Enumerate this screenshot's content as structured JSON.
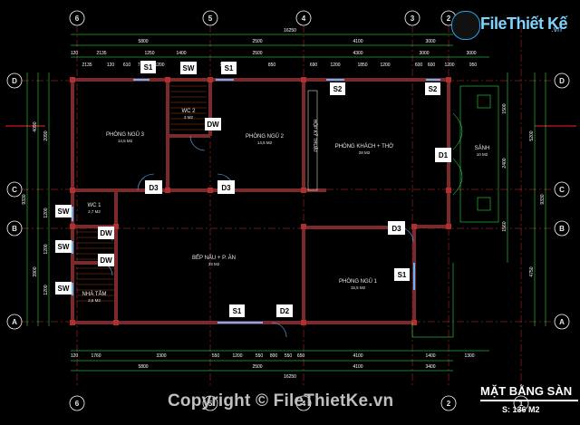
{
  "colors": {
    "wall": "#7a2a2a",
    "dim_line": "#39ff5a",
    "grid_line": "#ff4040",
    "hatch": "#ff6a2a",
    "window": "#5fb8ff",
    "tag_bg": "#ffffff"
  },
  "grid_axes": {
    "columns": [
      "6",
      "5",
      "4",
      "3",
      "2",
      "1"
    ],
    "rows": [
      "D",
      "C",
      "B",
      "A"
    ]
  },
  "overall": {
    "width_top": "16250",
    "width_bottom": "16250",
    "depth_left": "9330",
    "depth_right": "9330"
  },
  "dims_top": {
    "row1": [
      "5800",
      "2500",
      "4100",
      "3000"
    ],
    "row2": [
      "120",
      "2135",
      "1250",
      "1400",
      "2500",
      "4300",
      "3000",
      "3000"
    ],
    "row3": [
      "2135",
      "120",
      "610",
      "720",
      "1200",
      "990",
      "1200",
      "850",
      "690",
      "1200",
      "1850",
      "1200",
      "600",
      "600",
      "1200",
      "950"
    ]
  },
  "dims_bottom": {
    "row1": [
      "120",
      "1760",
      "3300",
      "550",
      "1200",
      "550",
      "800",
      "550",
      "650",
      "4100",
      "1400",
      "1300"
    ],
    "row2": [
      "5800",
      "2500",
      "4100",
      "3400"
    ]
  },
  "dims_left": [
    "4090",
    "3900",
    "9330",
    "2090",
    "1200",
    "1200",
    "1200"
  ],
  "dims_right": [
    "5200",
    "4750",
    "9330",
    "1500",
    "2400",
    "1560"
  ],
  "rooms": [
    {
      "name": "PHÒNG NGỦ 3",
      "area": "14,5 M2"
    },
    {
      "name": "WC 2",
      "area": "3 M2"
    },
    {
      "name": "PHÒNG NGỦ 2",
      "area": "14,5 M2"
    },
    {
      "name": "PHÒNG KHÁCH + THỜ",
      "area": "28 M2"
    },
    {
      "name": "SẢNH",
      "area": "10 M2"
    },
    {
      "name": "WC 1",
      "area": "2,7 M2"
    },
    {
      "name": "BẾP NẤU + P. ĂN",
      "area": "33 M2"
    },
    {
      "name": "PHÒNG NGỦ 1",
      "area": "15,5 M2"
    },
    {
      "name": "NHÀ TẮM",
      "area": "3,5 M2"
    }
  ],
  "vertical_label": "HỘP KỸ THUẬT",
  "door_window_tags": [
    "S1",
    "SW",
    "S1",
    "S2",
    "S2",
    "DW",
    "D1",
    "D3",
    "D3",
    "SW",
    "DW",
    "SW",
    "DW",
    "SW",
    "D3",
    "S1",
    "S1",
    "D2"
  ],
  "logo": {
    "text": "FileThiết Kế",
    "tld": ".vn"
  },
  "copyright": "Copyright © FileThietKe.vn",
  "plan_title": "MẶT BẰNG SÀN",
  "plan_area": "S: 136 M2"
}
